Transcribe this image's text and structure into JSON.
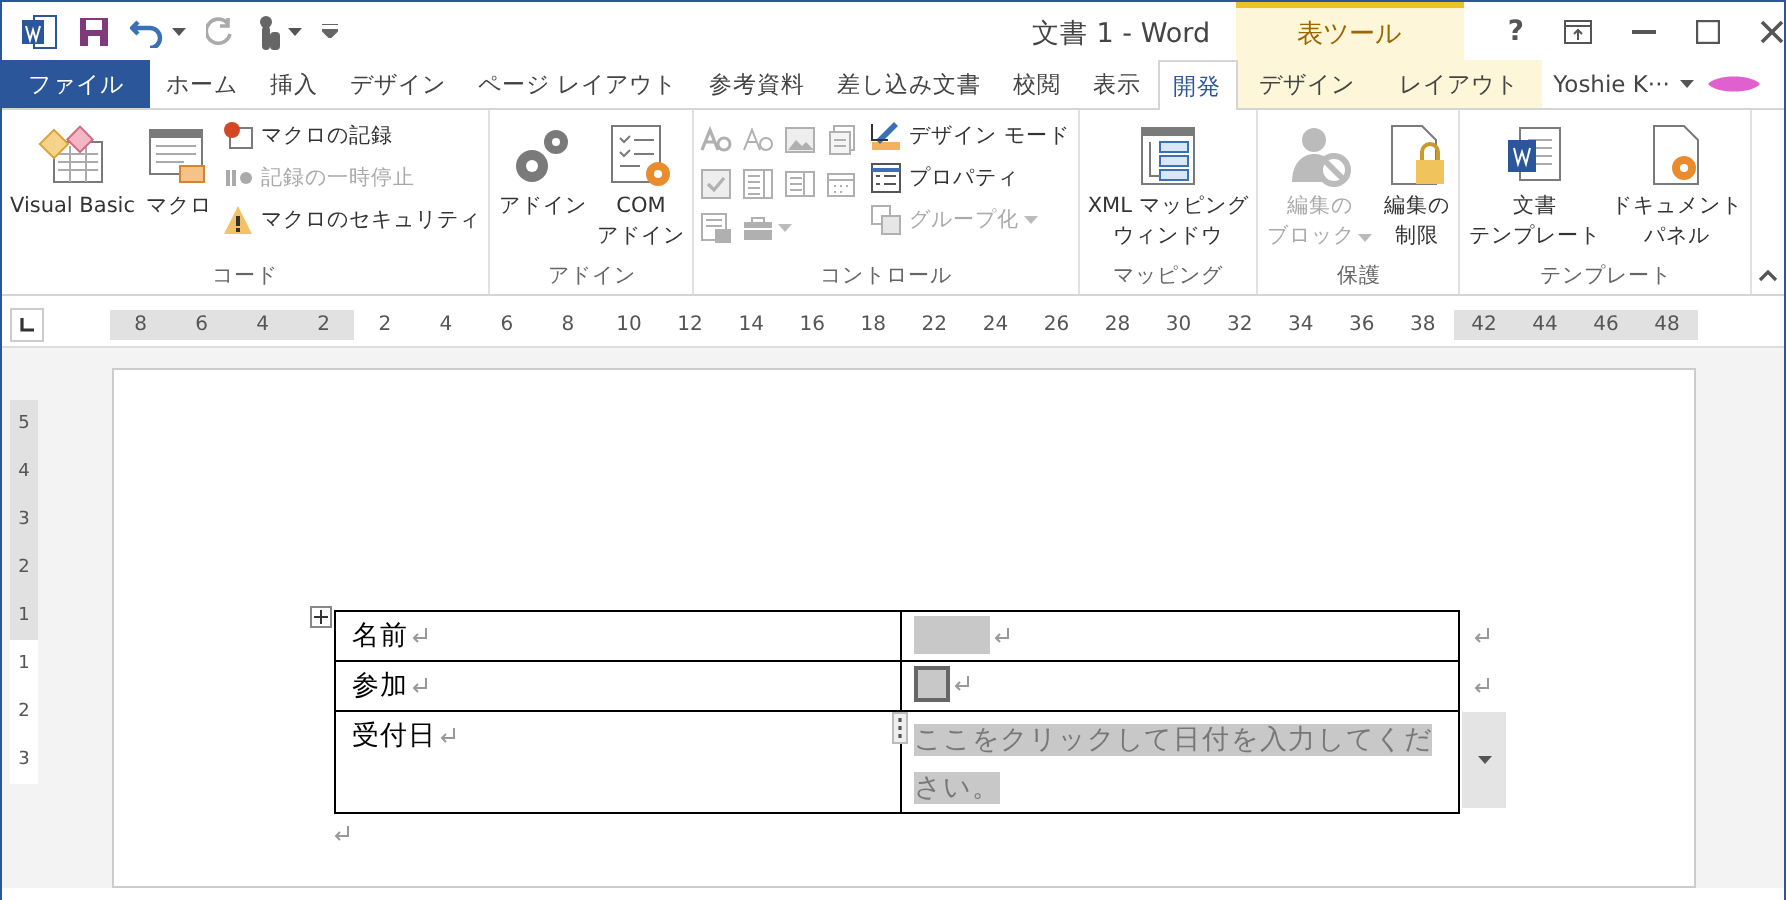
{
  "window": {
    "title": "文書 1 - Word",
    "context_title": "表ツール",
    "help": "?",
    "user": "Yoshie K···"
  },
  "tabs": [
    {
      "label": "ファイル",
      "kind": "file",
      "selected": false
    },
    {
      "label": "ホーム",
      "kind": "normal",
      "selected": false
    },
    {
      "label": "挿入",
      "kind": "normal",
      "selected": false
    },
    {
      "label": "デザイン",
      "kind": "normal",
      "selected": false
    },
    {
      "label": "ページ レイアウト",
      "kind": "normal",
      "selected": false
    },
    {
      "label": "参考資料",
      "kind": "normal",
      "selected": false
    },
    {
      "label": "差し込み文書",
      "kind": "normal",
      "selected": false
    },
    {
      "label": "校閲",
      "kind": "normal",
      "selected": false
    },
    {
      "label": "表示",
      "kind": "normal",
      "selected": false
    },
    {
      "label": "開発",
      "kind": "normal",
      "selected": true
    },
    {
      "label": "デザイン",
      "kind": "context",
      "selected": false
    },
    {
      "label": "レイアウト",
      "kind": "context",
      "selected": false
    }
  ],
  "ribbon": {
    "groups": [
      {
        "label": "コード",
        "items": [
          {
            "kind": "large",
            "lines": [
              "Visual Basic"
            ],
            "disabled": false,
            "menu": false
          },
          {
            "kind": "large",
            "lines": [
              "マクロ"
            ],
            "disabled": false,
            "menu": false
          },
          {
            "kind": "small",
            "lines": [
              "マクロの記録"
            ],
            "disabled": false,
            "menu": false
          },
          {
            "kind": "small",
            "lines": [
              "記録の一時停止"
            ],
            "disabled": true,
            "menu": false
          },
          {
            "kind": "small",
            "lines": [
              "マクロのセキュリティ"
            ],
            "disabled": false,
            "menu": false
          }
        ]
      },
      {
        "label": "アドイン",
        "items": [
          {
            "kind": "large",
            "lines": [
              "アドイン"
            ],
            "disabled": false,
            "menu": false
          },
          {
            "kind": "large",
            "lines": [
              "COM",
              "アドイン"
            ],
            "disabled": false,
            "menu": false
          }
        ]
      },
      {
        "label": "コントロール",
        "items": [
          {
            "kind": "icon",
            "disabled": true,
            "menu": false
          },
          {
            "kind": "icon",
            "disabled": true,
            "menu": false
          },
          {
            "kind": "icon",
            "disabled": true,
            "menu": false
          },
          {
            "kind": "icon",
            "disabled": true,
            "menu": false
          },
          {
            "kind": "icon",
            "disabled": true,
            "menu": false
          },
          {
            "kind": "icon",
            "disabled": true,
            "menu": false
          },
          {
            "kind": "icon",
            "disabled": true,
            "menu": false
          },
          {
            "kind": "icon",
            "disabled": true,
            "menu": false
          },
          {
            "kind": "icon",
            "disabled": true,
            "menu": false
          },
          {
            "kind": "icon",
            "disabled": true,
            "menu": true
          },
          {
            "kind": "small",
            "lines": [
              "デザイン モード"
            ],
            "disabled": false,
            "menu": false
          },
          {
            "kind": "small",
            "lines": [
              "プロパティ"
            ],
            "disabled": false,
            "menu": false
          },
          {
            "kind": "small",
            "lines": [
              "グループ化"
            ],
            "disabled": true,
            "menu": true
          }
        ]
      },
      {
        "label": "マッピング",
        "items": [
          {
            "kind": "large",
            "lines": [
              "XML マッピング",
              "ウィンドウ"
            ],
            "disabled": false,
            "menu": false
          }
        ]
      },
      {
        "label": "保護",
        "items": [
          {
            "kind": "large",
            "lines": [
              "編集の",
              "ブロック"
            ],
            "disabled": true,
            "menu": true
          },
          {
            "kind": "large",
            "lines": [
              "編集の",
              "制限"
            ],
            "disabled": false,
            "menu": false
          }
        ]
      },
      {
        "label": "テンプレート",
        "items": [
          {
            "kind": "large",
            "lines": [
              "文書",
              "テンプレート"
            ],
            "disabled": false,
            "menu": false
          },
          {
            "kind": "large",
            "lines": [
              "ドキュメント",
              "パネル"
            ],
            "disabled": false,
            "menu": false
          }
        ]
      }
    ]
  },
  "ruler": {
    "marks": [
      {
        "label": "8",
        "margin": true
      },
      {
        "label": "6",
        "margin": true
      },
      {
        "label": "4",
        "margin": true
      },
      {
        "label": "2",
        "margin": true
      },
      {
        "label": "2",
        "margin": false
      },
      {
        "label": "4",
        "margin": false
      },
      {
        "label": "6",
        "margin": false
      },
      {
        "label": "8",
        "margin": false
      },
      {
        "label": "10",
        "margin": false
      },
      {
        "label": "12",
        "margin": false
      },
      {
        "label": "14",
        "margin": false
      },
      {
        "label": "16",
        "margin": false
      },
      {
        "label": "18",
        "margin": false
      },
      {
        "label": "22",
        "margin": false
      },
      {
        "label": "24",
        "margin": false
      },
      {
        "label": "26",
        "margin": false
      },
      {
        "label": "28",
        "margin": false
      },
      {
        "label": "30",
        "margin": false
      },
      {
        "label": "32",
        "margin": false
      },
      {
        "label": "34",
        "margin": false
      },
      {
        "label": "36",
        "margin": false
      },
      {
        "label": "38",
        "margin": false
      },
      {
        "label": "42",
        "margin": true
      },
      {
        "label": "44",
        "margin": true
      },
      {
        "label": "46",
        "margin": true
      },
      {
        "label": "48",
        "margin": true
      }
    ]
  },
  "vertical_ruler": {
    "marks": [
      {
        "label": "5",
        "margin": true
      },
      {
        "label": "4",
        "margin": true
      },
      {
        "label": "3",
        "margin": true
      },
      {
        "label": "2",
        "margin": true
      },
      {
        "label": "1",
        "margin": true
      },
      {
        "label": "1",
        "margin": false
      },
      {
        "label": "2",
        "margin": false
      },
      {
        "label": "3",
        "margin": false
      }
    ]
  },
  "table": {
    "rows": [
      {
        "label": "名前",
        "kind": "text"
      },
      {
        "label": "参加",
        "kind": "checkbox",
        "checked": false
      },
      {
        "label": "受付日",
        "kind": "date",
        "placeholder": "ここをクリックして日付を入力してください。"
      }
    ]
  }
}
